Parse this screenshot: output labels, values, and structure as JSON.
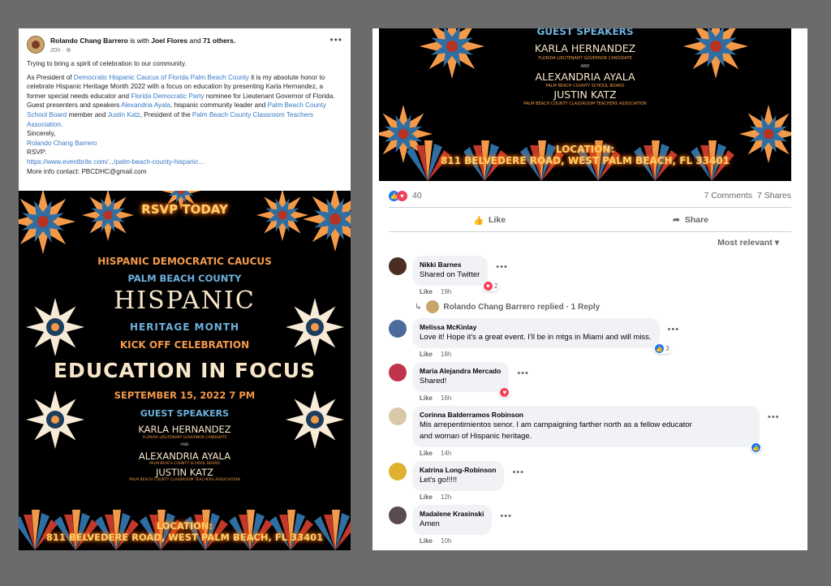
{
  "post": {
    "author": "Rolando Chang Barrero",
    "with_text": "is with",
    "tagged": "Joel Flores",
    "and_text": "and",
    "others": "71 others.",
    "time": "20h ·",
    "intro": "Trying to bring a spirit of celebration to our community.",
    "p1a": "As President of ",
    "p1b": "Democratic Hispanic Caucus of Florida Palm Beach County",
    "p1c": " it is my absolute honor to celebrate Hispanic Heritage Month 2022 with a focus on education by presenting Karla Hernandez, a former special needs educator and ",
    "p1d": "Florida Democratic Party",
    "p1e": " nominee for Lieutenant Governor of Florida.",
    "p2a": "Guest presenters and speakers ",
    "p2b": "Alexandria Ayala",
    "p2c": ", hispanic community leader and ",
    "p2d": "Palm Beach County School Board",
    "p2e": " member and ",
    "p2f": "Justin Katz",
    "p2g": ", President of the ",
    "p2h": "Palm Beach County Classroom Teachers Association",
    "p2i": ".",
    "sincerely": "Sincerely,",
    "sign": "Rolando Chang Barrero",
    "rsvp": "RSVP:",
    "link": "https://www.eventbrite.com/.../palm-beach-county-hispanic...",
    "contact": "More info contact: PBCDHC@gmail.com"
  },
  "flyer": {
    "rsvp": "RSVP TODAY",
    "caucus": "HISPANIC DEMOCRATIC CAUCUS",
    "county": "PALM BEACH COUNTY",
    "hispanic": "HISPANIC",
    "heritage": "HERITAGE MONTH",
    "kickoff": "KICK OFF CELEBRATION",
    "edu": "EDUCATION IN FOCUS",
    "date": "SEPTEMBER 15, 2022 7 PM",
    "guest": "GUEST SPEAKERS",
    "s1": "KARLA HERNANDEZ",
    "s1sub": "FLORIDA LIEUTENANT GOVERNOR CANDIDATE",
    "and": "AND",
    "s2": "ALEXANDRIA AYALA",
    "s2sub": "PALM BEACH COUNTY SCHOOL BOARD",
    "s3": "JUSTIN KATZ",
    "s3sub": "PALM BEACH COUNTY CLASSROOM TEACHERS ASSOCIATION",
    "loc1": "LOCATION:",
    "loc2": "811 BELVEDERE ROAD, WEST PALM BEACH, FL 33401"
  },
  "stats": {
    "reactions": "40",
    "comments": "7 Comments",
    "shares": "7 Shares"
  },
  "actions": {
    "like": "Like",
    "share": "Share"
  },
  "sort": "Most relevant",
  "comments": [
    {
      "name": "Nikki Barnes",
      "text": "Shared on Twitter",
      "like": "Like",
      "time": "19h",
      "count": "2"
    },
    {
      "name": "Melissa McKinlay",
      "text": "Love it! Hope it's a great event. I'll be in mtgs in Miami and will miss.",
      "like": "Like",
      "time": "18h",
      "count": "3"
    },
    {
      "name": "Maria Alejandra Mercado",
      "text": "Shared!",
      "like": "Like",
      "time": "16h"
    },
    {
      "name": "Corinna Balderramos Robinson",
      "text": "Mis arrepentimientos senor. I am campaigning farther north as a fellow educator",
      "text2": "and woman of Hispanic heritage.",
      "like": "Like",
      "time": "14h"
    },
    {
      "name": "Katrina Long-Robinson",
      "text": "Let's go!!!!!",
      "like": "Like",
      "time": "12h"
    },
    {
      "name": "Madalene Krasinski",
      "text": "Amen",
      "like": "Like",
      "time": "10h"
    }
  ],
  "reply": {
    "name": "Rolando Chang Barrero",
    "text": "replied · 1 Reply"
  },
  "colors": {
    "link": "#3578c7",
    "flyer_orange": "#f39a4a",
    "flyer_blue": "#6db1dd",
    "fb_blue": "#1877f2",
    "love_red": "#f33e58"
  }
}
